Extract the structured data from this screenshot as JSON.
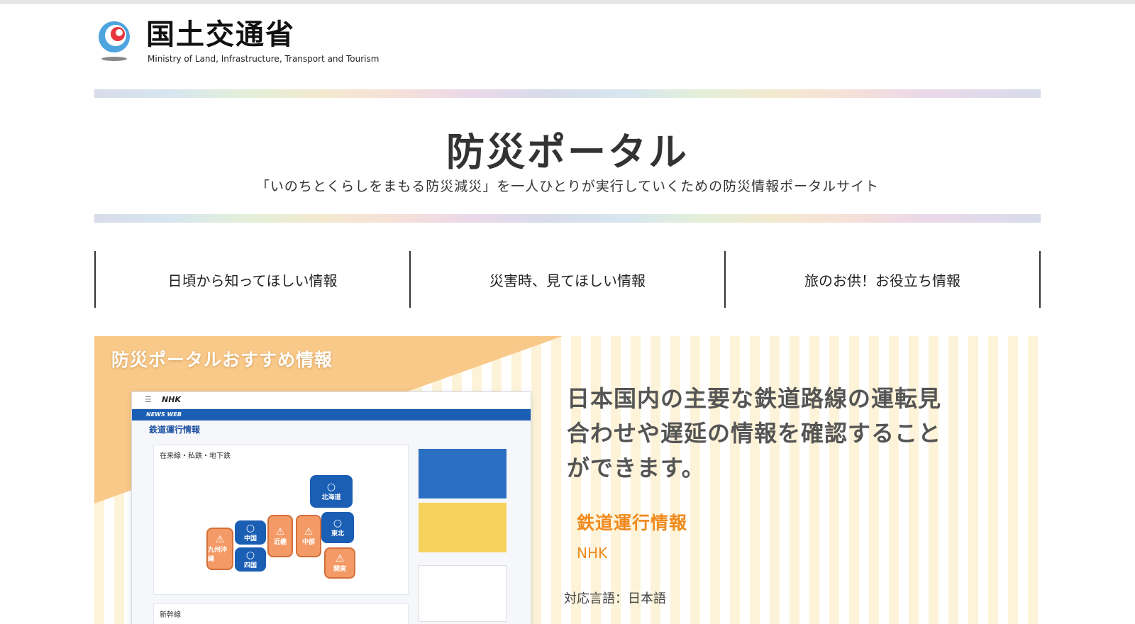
{
  "header": {
    "logo_jp": "国土交通省",
    "logo_en": "Ministry of Land, Infrastructure, Transport and Tourism"
  },
  "hero": {
    "title": "防災ポータル",
    "subtitle": "「いのちとくらしをまもる防災減災」を一人ひとりが実行していくための防災情報ポータルサイト"
  },
  "nav": {
    "items": [
      {
        "label": "日頃から知ってほしい情報"
      },
      {
        "label": "災害時、見てほしい情報"
      },
      {
        "label": "旅のお供！お役立ち情報"
      }
    ]
  },
  "banner": {
    "label": "防災ポータルおすすめ情報",
    "description": "日本国内の主要な鉄道路線の運転見合わせや遅延の情報を確認することができます。",
    "link_title": "鉄道運行情報",
    "source": "NHK",
    "language": "対応言語：日本語",
    "screenshot": {
      "brand": "NHK",
      "menu": "☰",
      "newsweb": "NEWS WEB",
      "heading": "鉄道運行情報",
      "panel_title": "在来線・私鉄・地下鉄",
      "footer_title": "新幹線",
      "regions": [
        {
          "name": "北海道",
          "status": "○"
        },
        {
          "name": "東北",
          "status": "○"
        },
        {
          "name": "中国",
          "status": "○"
        },
        {
          "name": "四国",
          "status": "○"
        },
        {
          "name": "近畿",
          "status": "⚠"
        },
        {
          "name": "中部",
          "status": "⚠"
        },
        {
          "name": "関東",
          "status": "⚠"
        },
        {
          "name": "九州沖縄",
          "status": "⚠"
        }
      ]
    }
  },
  "colors": {
    "accent_orange": "#f08a1c",
    "nhk_blue": "#1b5fb5",
    "banner_peach": "#f9c98a"
  }
}
